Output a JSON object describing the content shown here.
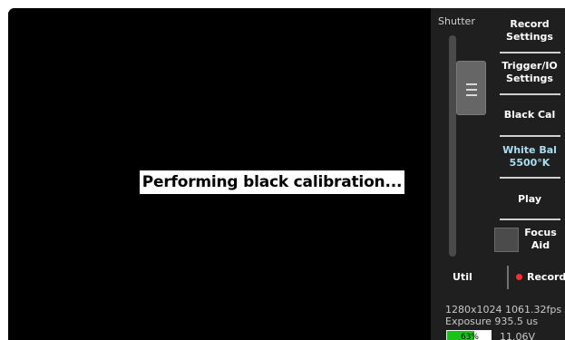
{
  "message": "Performing black calibration...",
  "shutter": {
    "label": "Shutter",
    "level": 0.92
  },
  "menu": {
    "record_settings": [
      "Record",
      "Settings"
    ],
    "trigger_io_settings": [
      "Trigger/IO",
      "Settings"
    ],
    "black_cal": "Black Cal",
    "white_bal": [
      "White Bal",
      "5500°K"
    ],
    "play": "Play",
    "focus_aid": [
      "Focus",
      "Aid"
    ]
  },
  "bottom_buttons": {
    "util": "Util",
    "record": "Record"
  },
  "status": {
    "resolution_fps": "1280x1024 1061.32fps",
    "exposure": "Exposure 935.5 us",
    "battery_percent": "63%",
    "battery_level": 0.63,
    "voltage": "11.06V"
  },
  "colors": {
    "screen_background": "#000000",
    "panel_background": "#1f1f1f",
    "white_balance_text": "#a9def2",
    "record_dot": "#ff2d2d",
    "battery_fill": "#19c31a"
  },
  "icons": {
    "shutter_handle": "shutter-slider-handle-icon",
    "record_indicator": "record-dot-icon",
    "battery": "battery-icon"
  }
}
